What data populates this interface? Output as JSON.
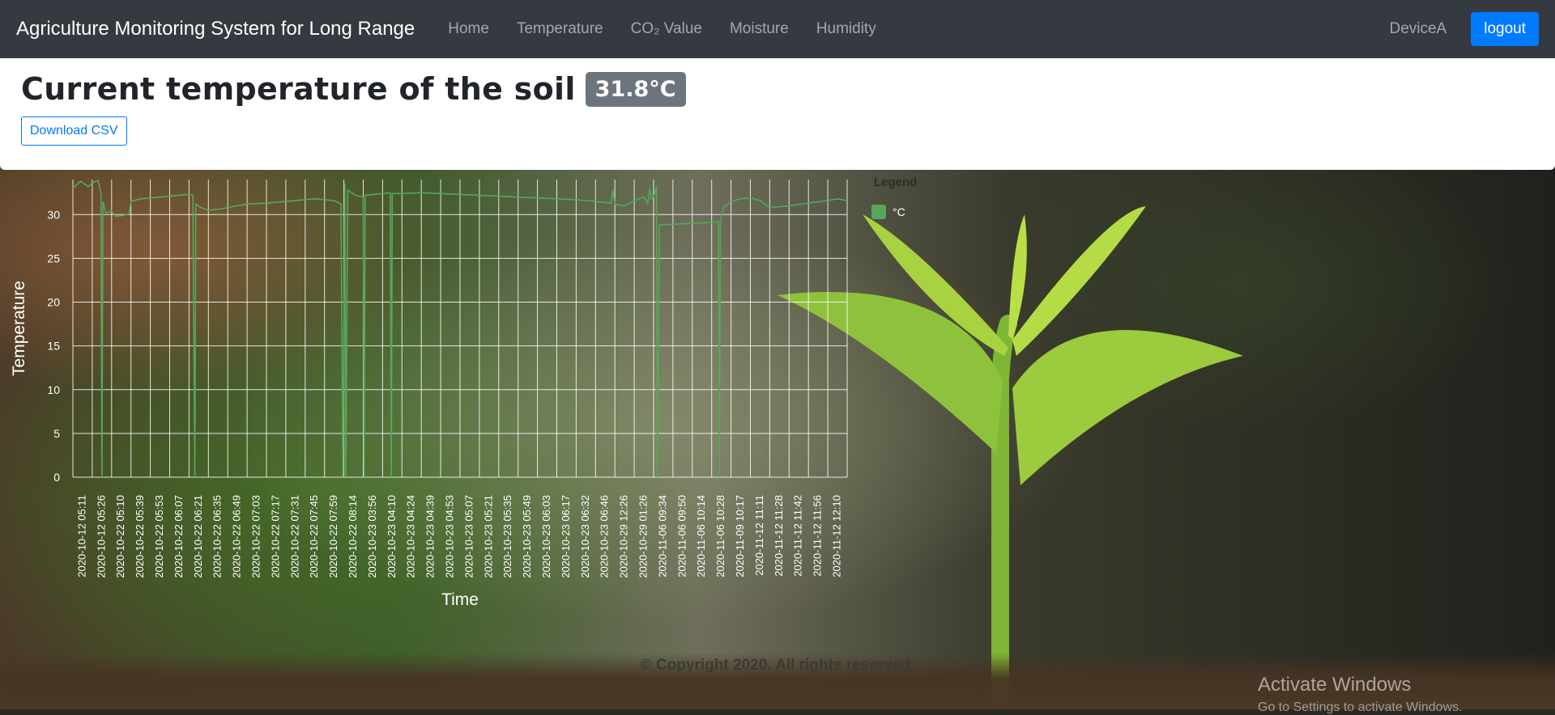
{
  "navbar": {
    "brand": "Agriculture Monitoring System for Long Range",
    "links": [
      "Home",
      "Temperature",
      "CO₂ Value",
      "Moisture",
      "Humidity"
    ],
    "device": "DeviceA",
    "logout_label": "logout"
  },
  "header": {
    "title": "Current temperature of the soil",
    "current_value": "31.8°C",
    "download_label": "Download CSV"
  },
  "chart_data": {
    "type": "line",
    "xlabel": "Time",
    "ylabel": "Temperature",
    "ylim": [
      0,
      34
    ],
    "yticks": [
      0,
      5,
      10,
      15,
      20,
      25,
      30
    ],
    "grid": true,
    "legend_title": "Legend",
    "legend_position": "top-right",
    "categories": [
      "2020-10-12 05:11",
      "2020-10-12 05:26",
      "2020-10-22 05:10",
      "2020-10-22 05:39",
      "2020-10-22 05:53",
      "2020-10-22 06:07",
      "2020-10-22 06:21",
      "2020-10-22 06:35",
      "2020-10-22 06:49",
      "2020-10-22 07:03",
      "2020-10-22 07:17",
      "2020-10-22 07:31",
      "2020-10-22 07:45",
      "2020-10-22 07:59",
      "2020-10-22 08:14",
      "2020-10-23 03:56",
      "2020-10-23 04:10",
      "2020-10-23 04:24",
      "2020-10-23 04:39",
      "2020-10-23 04:53",
      "2020-10-23 05:07",
      "2020-10-23 05:21",
      "2020-10-23 05:35",
      "2020-10-23 05:49",
      "2020-10-23 06:03",
      "2020-10-23 06:17",
      "2020-10-23 06:32",
      "2020-10-23 06:46",
      "2020-10-29 12:26",
      "2020-10-29 01:26",
      "2020-11-06 09:34",
      "2020-11-06 09:50",
      "2020-11-06 10:14",
      "2020-11-06 10:28",
      "2020-11-09 10:17",
      "2020-11-12 11:11",
      "2020-11-12 11:28",
      "2020-11-12 11:42",
      "2020-11-12 11:56",
      "2020-11-12 12:10"
    ],
    "series": [
      {
        "name": "°C",
        "color": "#58a65c",
        "values": [
          [
            0,
            33.0
          ],
          [
            0.4,
            33.8
          ],
          [
            0.8,
            33.2
          ],
          [
            1.0,
            33.6
          ],
          [
            1.3,
            33.9
          ],
          [
            1.45,
            32.5
          ],
          [
            1.5,
            0
          ],
          [
            1.55,
            31.5
          ],
          [
            1.7,
            30.2
          ],
          [
            2.0,
            30.4
          ],
          [
            2.2,
            29.8
          ],
          [
            2.6,
            29.9
          ],
          [
            2.9,
            30.1
          ],
          [
            3.0,
            31.5
          ],
          [
            3.5,
            31.8
          ],
          [
            4.0,
            31.9
          ],
          [
            5.0,
            32.1
          ],
          [
            5.5,
            32.2
          ],
          [
            6.0,
            32.3
          ],
          [
            6.2,
            32.2
          ],
          [
            6.3,
            0
          ],
          [
            6.35,
            31.2
          ],
          [
            6.6,
            30.8
          ],
          [
            7.0,
            30.5
          ],
          [
            7.5,
            30.6
          ],
          [
            8.0,
            30.8
          ],
          [
            9.0,
            31.2
          ],
          [
            10.0,
            31.3
          ],
          [
            11.0,
            31.5
          ],
          [
            12.0,
            31.7
          ],
          [
            12.5,
            31.8
          ],
          [
            13.5,
            31.6
          ],
          [
            13.85,
            31.2
          ],
          [
            13.95,
            0
          ],
          [
            14.05,
            33.5
          ],
          [
            14.1,
            0
          ],
          [
            14.2,
            32.8
          ],
          [
            14.6,
            32.2
          ],
          [
            15.0,
            32.0
          ],
          [
            15.05,
            0
          ],
          [
            15.1,
            32.2
          ],
          [
            15.5,
            32.3
          ],
          [
            16.0,
            32.4
          ],
          [
            16.4,
            32.5
          ],
          [
            16.45,
            0
          ],
          [
            16.5,
            32.4
          ],
          [
            17.0,
            32.4
          ],
          [
            18.0,
            32.5
          ],
          [
            19.0,
            32.4
          ],
          [
            20.0,
            32.3
          ],
          [
            21.0,
            32.2
          ],
          [
            22.0,
            32.1
          ],
          [
            23.0,
            32.0
          ],
          [
            24.0,
            31.9
          ],
          [
            25.0,
            31.8
          ],
          [
            26.0,
            31.7
          ],
          [
            27.0,
            31.5
          ],
          [
            27.8,
            31.3
          ],
          [
            27.9,
            32.8
          ],
          [
            28.0,
            31.2
          ],
          [
            28.4,
            31.0
          ],
          [
            28.7,
            31.2
          ],
          [
            29.0,
            31.6
          ],
          [
            29.5,
            32.0
          ],
          [
            29.7,
            31.3
          ],
          [
            29.8,
            33.0
          ],
          [
            29.9,
            31.8
          ],
          [
            30.0,
            32.0
          ],
          [
            30.15,
            33.2
          ],
          [
            30.2,
            0
          ],
          [
            30.3,
            28.8
          ],
          [
            31.0,
            28.9
          ],
          [
            32.0,
            29.0
          ],
          [
            33.0,
            29.1
          ],
          [
            33.35,
            29.2
          ],
          [
            33.4,
            0
          ],
          [
            33.45,
            29.3
          ],
          [
            33.6,
            30.8
          ],
          [
            34.0,
            31.5
          ],
          [
            34.5,
            31.8
          ],
          [
            35.0,
            31.9
          ],
          [
            35.5,
            31.6
          ],
          [
            36.0,
            30.8
          ],
          [
            37.0,
            31.0
          ],
          [
            38.0,
            31.3
          ],
          [
            39.0,
            31.6
          ],
          [
            39.5,
            31.8
          ],
          [
            40.0,
            31.6
          ]
        ]
      }
    ]
  },
  "footer": {
    "text": "© Copyright 2020. All rights reserved."
  },
  "watermark": {
    "title": "Activate Windows",
    "subtitle": "Go to Settings to activate Windows."
  },
  "colors": {
    "navbar": "#343a40",
    "accent": "#007bff",
    "badge": "#6c757d",
    "series": "#58a65c"
  }
}
